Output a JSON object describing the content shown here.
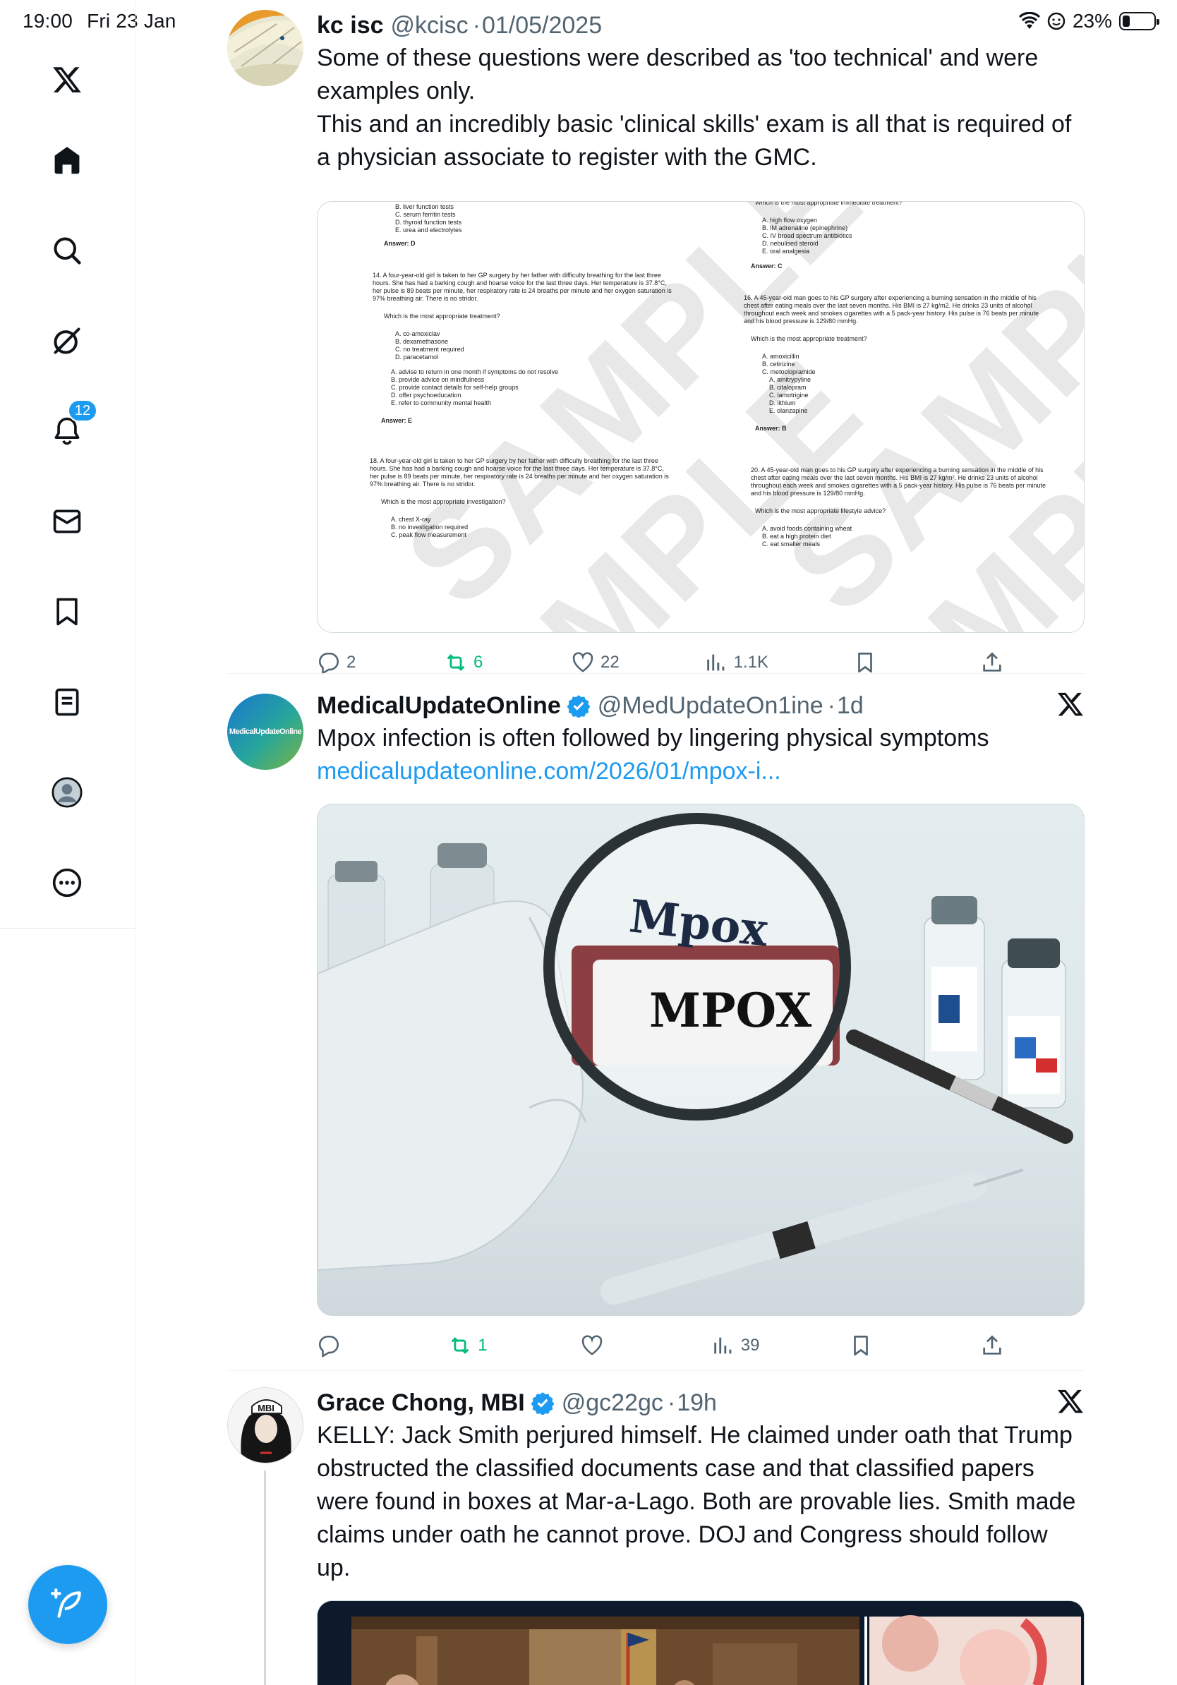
{
  "status_bar": {
    "time": "19:00",
    "date": "Fri 23 Jan",
    "battery": "23%"
  },
  "sidebar": {
    "notifications_badge": "12",
    "items": [
      "home",
      "explore",
      "grok",
      "notifications",
      "messages",
      "bookmarks",
      "lists",
      "profile",
      "more"
    ]
  },
  "tweets": [
    {
      "name": "kc isc",
      "handle": "@kcisc",
      "time": "01/05/2025",
      "text_1": "Some of these questions were described as 'too technical' and were examples only.",
      "text_2": "This and an incredibly basic 'clinical skills' exam is all that is required of a physician associate to register with the GMC.",
      "replies": "2",
      "retweets": "6",
      "likes": "22",
      "views": "1.1K"
    },
    {
      "name": "MedicalUpdateOnline",
      "handle": "@MedUpdateOn1ine",
      "time": "1d",
      "avatar_text": "MedicalUpdateOnline",
      "text": "Mpox infection is often followed by lingering physical symptoms",
      "link": "medicalupdateonline.com/2026/01/mpox-i...",
      "image_word_1": "Mpox",
      "image_word_2": "MPOX",
      "replies": "",
      "retweets": "1",
      "likes": "",
      "views": "39"
    },
    {
      "name": "Grace Chong, MBI",
      "handle": "@gc22gc",
      "time": "19h",
      "avatar_text": "MBI",
      "text": "KELLY: Jack Smith perjured himself. He claimed under oath that Trump obstructed the classified documents case and that classified papers were found in boxes at Mar-a-Lago. Both are provable lies. Smith made claims under oath he cannot prove. DOJ and Congress should follow up."
    }
  ],
  "document": {
    "watermark": "SAMPLE",
    "col1": {
      "opts_top": [
        "B.  liver function tests",
        "C.  serum ferritin tests",
        "D.  thyroid function tests",
        "E.  urea and electrolytes"
      ],
      "answer_top": "Answer: D",
      "q14": "14. A four-year-old girl is taken to her GP surgery by her father with difficulty breathing for the last three hours. She has had a barking cough and hoarse voice for the last three days. Her temperature is 37.8°C, her pulse is 89 beats per minute, her respiratory rate is 24 breaths per minute and her oxygen saturation is 97% breathing air. There is no stridor.",
      "q14_prompt": "Which is the most appropriate treatment?",
      "q14_opts": [
        "A.  co-amoxiclav",
        "B.  dexamethasone",
        "C.  no treatment required",
        "D.  paracetamol"
      ],
      "mid_opts": [
        "A.  advise to return in one month if symptoms do not resolve",
        "B.  provide advice on mindfulness",
        "C.  provide contact details for self-help groups",
        "D.  offer psychoeducation",
        "E.  refer to community mental health"
      ],
      "answer_mid": "Answer: E",
      "q18": "18. A four-year-old girl is taken to her GP surgery by her father with difficulty breathing for the last three hours. She has had a barking cough and hoarse voice for the last three days. Her temperature is 37.8°C, her pulse is 89 beats per minute, her respiratory rate is 24 breaths per minute and her oxygen saturation is 97% breathing air. There is no stridor.",
      "q18_prompt": "Which is the most appropriate investigation?",
      "q18_opts": [
        "A.  chest X-ray",
        "B.  no investigation required",
        "C.  peak flow measurement"
      ]
    },
    "col2": {
      "prompt_top": "Which is the most appropriate immediate treatment?",
      "opts_top": [
        "A.  high flow oxygen",
        "B.  IM adrenaline (epinephrine)",
        "C.  IV broad spectrum antibiotics",
        "D.  nebulised steroid",
        "E.  oral analgesia"
      ],
      "answer_top": "Answer: C",
      "q16": "16. A 45-year-old man goes to his GP surgery after experiencing a burning sensation in the middle of his chest after eating meals over the last seven months. His BMI is 27 kg/m2. He drinks 23 units of alcohol throughout each week and smokes cigarettes with a 5 pack-year history. His pulse is 76 beats per minute and his blood pressure is 129/80 mmHg.",
      "q16_prompt": "Which is the most appropriate treatment?",
      "q16_opts": [
        "A.  amoxicillin",
        "B.  cetirizine",
        "C.  metoclopramide"
      ],
      "mid_opts": [
        "A.  amitrypyline",
        "B.  citalopram",
        "C.  lamotrigine",
        "D.  lithium",
        "E.  olanzapine"
      ],
      "answer_mid": "Answer: B",
      "q20": "20. A 45-year-old man goes to his GP surgery after experiencing a burning sensation in the middle of his chest after eating meals over the last seven months. His BMI is 27 kg/m². He drinks 23 units of alcohol throughout each week and smokes cigarettes with a 5 pack-year history. His pulse is 76 beats per minute and his blood pressure is 129/80 mmHg.",
      "q20_prompt": "Which is the most appropriate lifestyle advice?",
      "q20_opts": [
        "A.  avoid foods containing wheat",
        "B.  eat a high protein diet",
        "C.  eat smaller meals"
      ]
    }
  },
  "colors": {
    "accent": "#1d9bf0",
    "retweet": "#00ba7c",
    "secondary_text": "#536471"
  }
}
